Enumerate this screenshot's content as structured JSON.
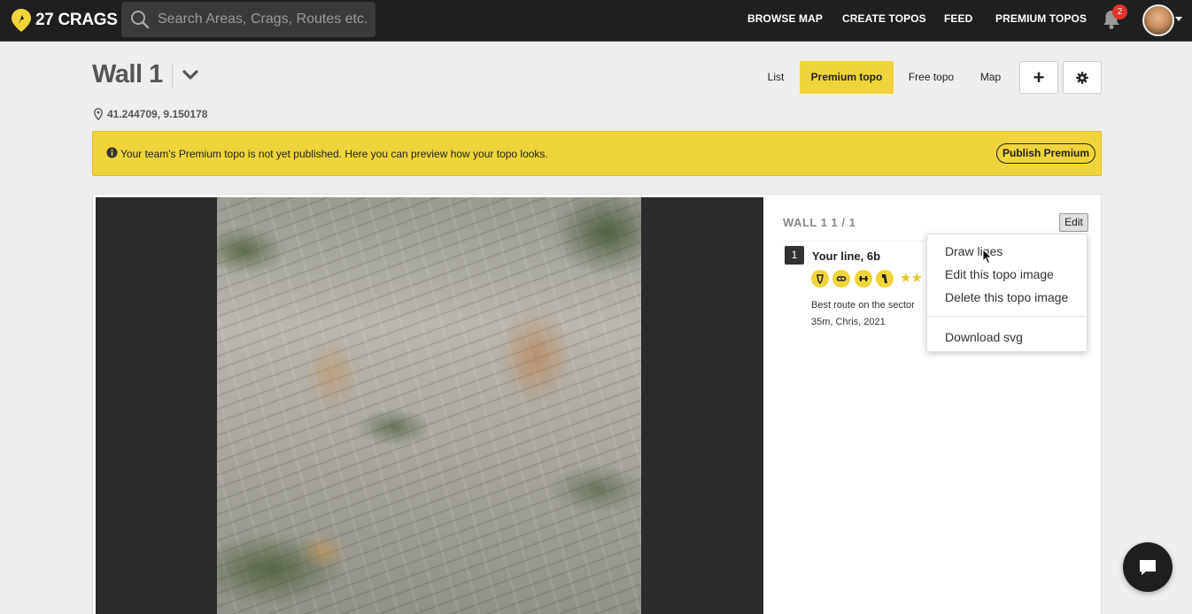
{
  "brand": {
    "name": "27 CRAGS",
    "accent": "#f0d43a"
  },
  "search": {
    "placeholder": "Search Areas, Crags, Routes etc."
  },
  "nav": {
    "links": [
      {
        "label": "BROWSE MAP"
      },
      {
        "label": "CREATE TOPOS"
      },
      {
        "label": "FEED"
      },
      {
        "label": "PREMIUM TOPOS"
      }
    ],
    "notifications_count": "2"
  },
  "header": {
    "title": "Wall 1",
    "coordinates": "41.244709, 9.150178",
    "tabs": [
      {
        "label": "List",
        "active": false
      },
      {
        "label": "Premium topo",
        "active": true
      },
      {
        "label": "Free topo",
        "active": false
      },
      {
        "label": "Map",
        "active": false
      }
    ],
    "add_button": "+"
  },
  "notice": {
    "text": "Your team's Premium topo is not yet published. Here you can preview how your topo looks.",
    "button": "Publish Premium"
  },
  "topo": {
    "heading": "WALL 1 1 / 1",
    "edit_label": "Edit",
    "route": {
      "number": "1",
      "name": "Your line, 6b",
      "tags": [
        "crimpy-icon",
        "sloper-icon",
        "endurance-icon",
        "technical-icon"
      ],
      "stars": "★★",
      "description_line1": "Best route on the sector",
      "description_line2": "35m, Chris, 2021"
    }
  },
  "dropdown": {
    "items": [
      {
        "label": "Draw lines"
      },
      {
        "label": "Edit this topo image"
      },
      {
        "label": "Delete this topo image"
      },
      {
        "label": "Download svg"
      }
    ]
  }
}
